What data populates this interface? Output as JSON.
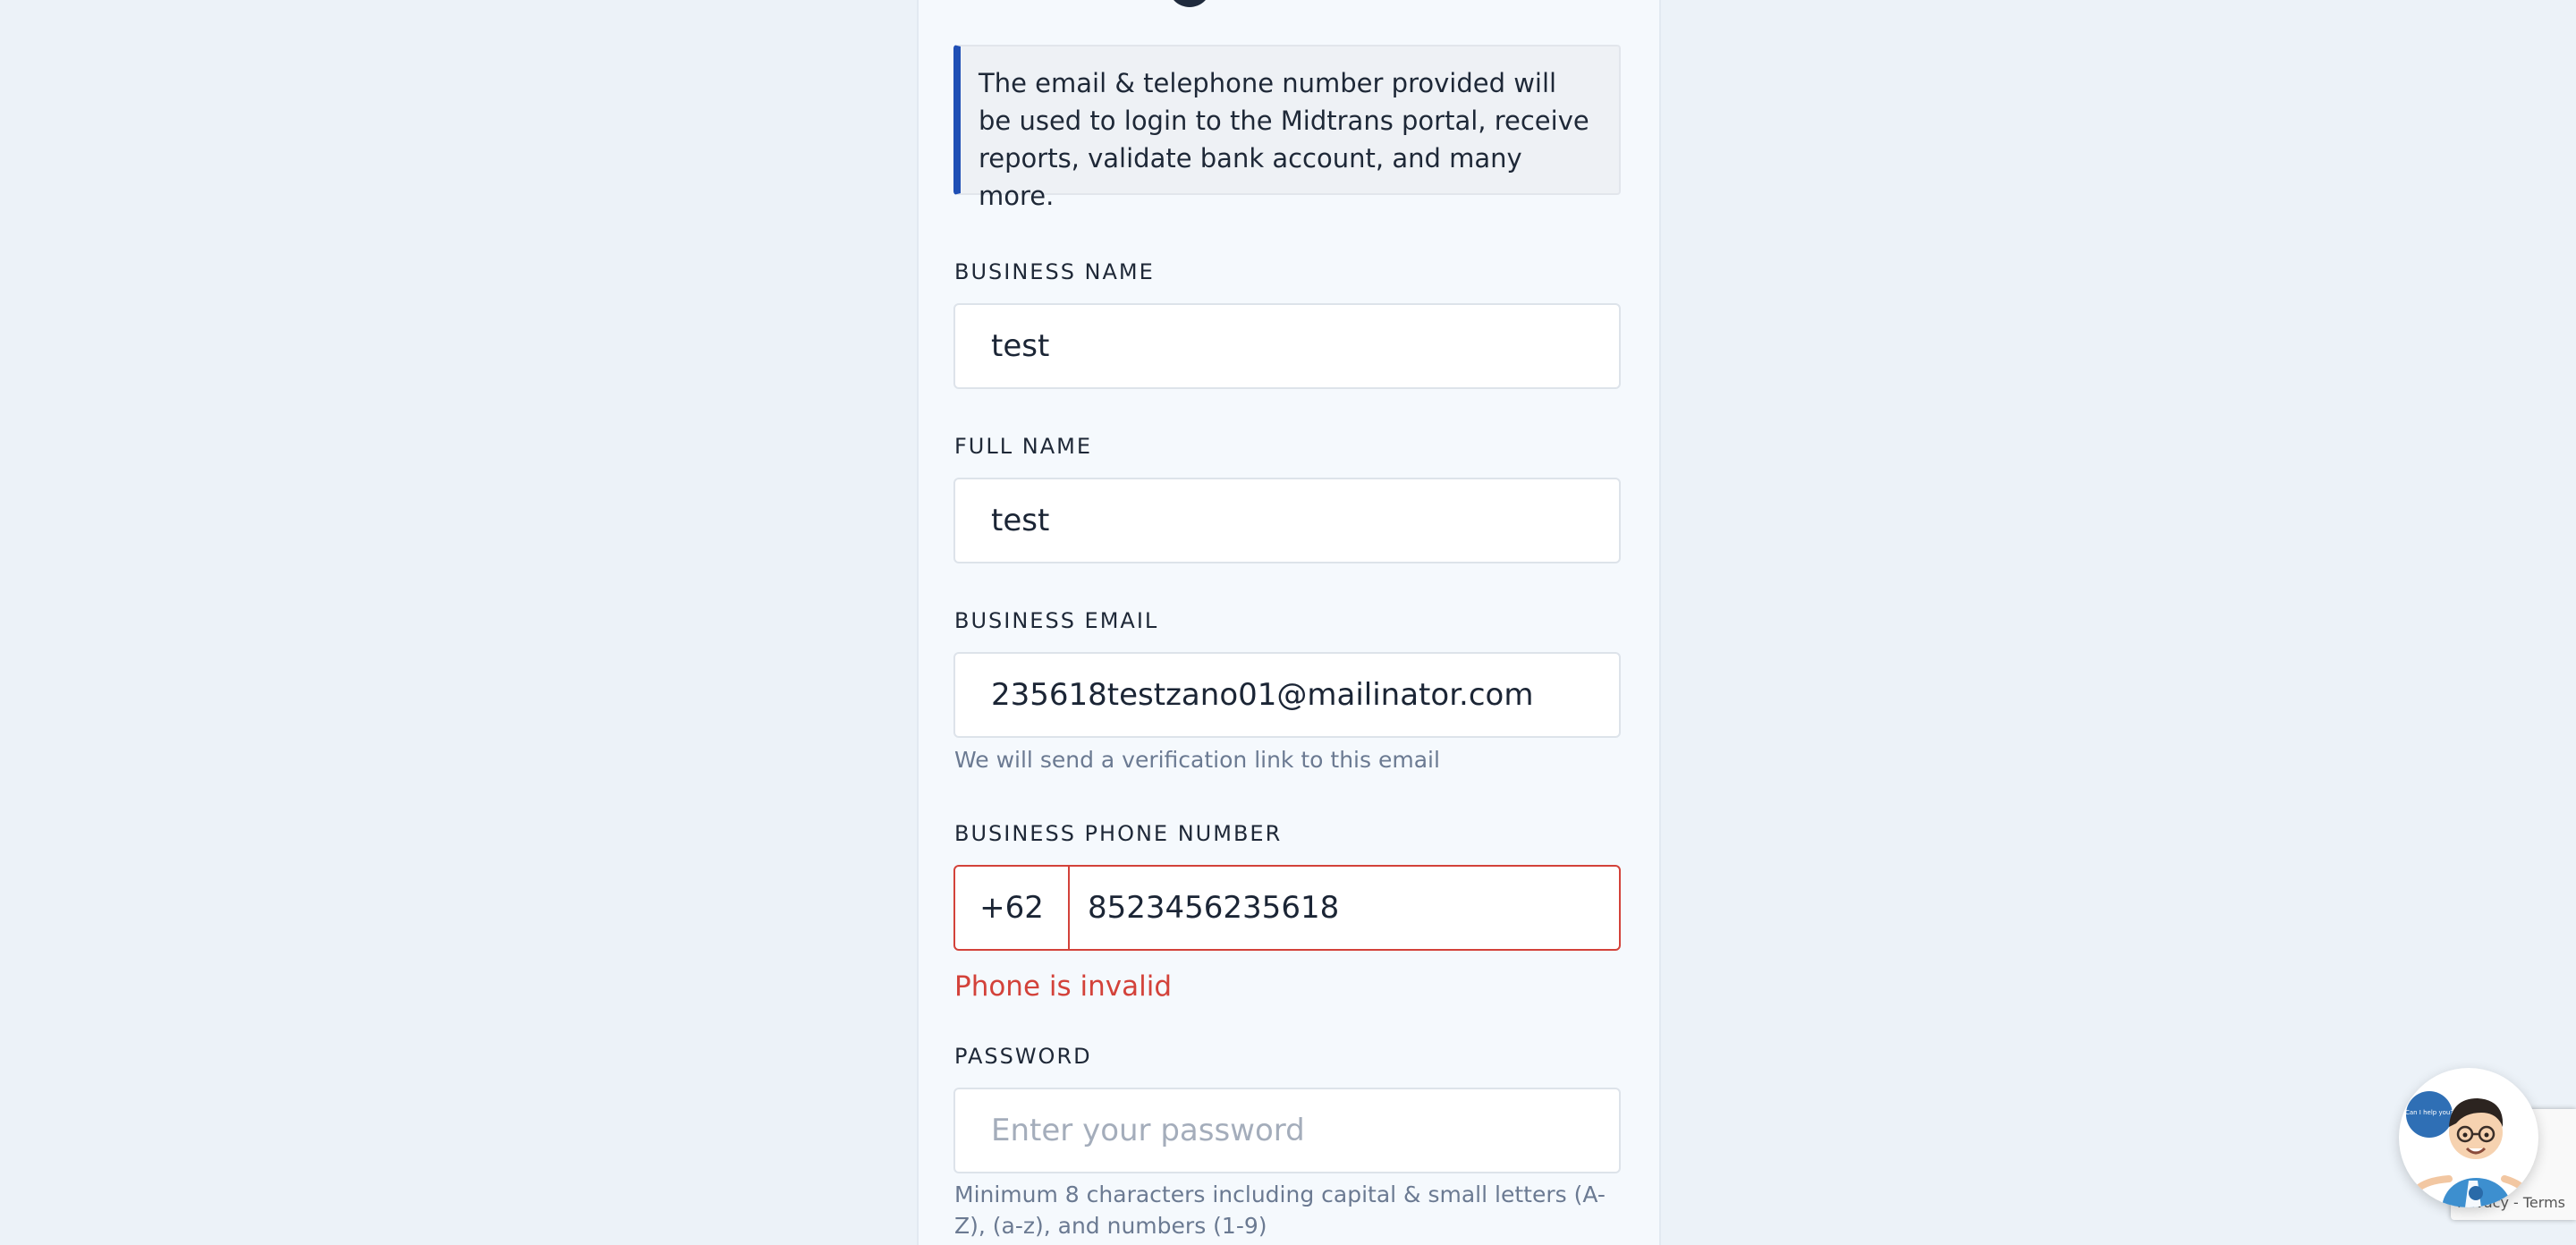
{
  "info": {
    "message": "The email & telephone number provided will be used to login to the Midtrans portal, receive reports, validate bank account, and many more."
  },
  "form": {
    "business_name": {
      "label": "BUSINESS NAME",
      "value": "test"
    },
    "full_name": {
      "label": "FULL NAME",
      "value": "test"
    },
    "business_email": {
      "label": "BUSINESS EMAIL",
      "value": "235618testzano01@mailinator.com",
      "helper": "We will send a verification link to this email"
    },
    "business_phone": {
      "label": "BUSINESS PHONE NUMBER",
      "prefix": "+62",
      "value": "8523456235618",
      "error": "Phone is invalid"
    },
    "password": {
      "label": "PASSWORD",
      "placeholder": "Enter your password",
      "helper": "Minimum 8 characters including capital & small letters (A-Z), (a-z), and numbers (1-9)"
    }
  },
  "widgets": {
    "recaptcha_terms": "Privacy - Terms",
    "chat_icon": "chat-assistant-avatar-icon",
    "chat_bubble_text": "Can I help you?"
  },
  "colors": {
    "accent": "#1f4fb5",
    "error": "#d3423a",
    "background": "#ecf2f8"
  }
}
